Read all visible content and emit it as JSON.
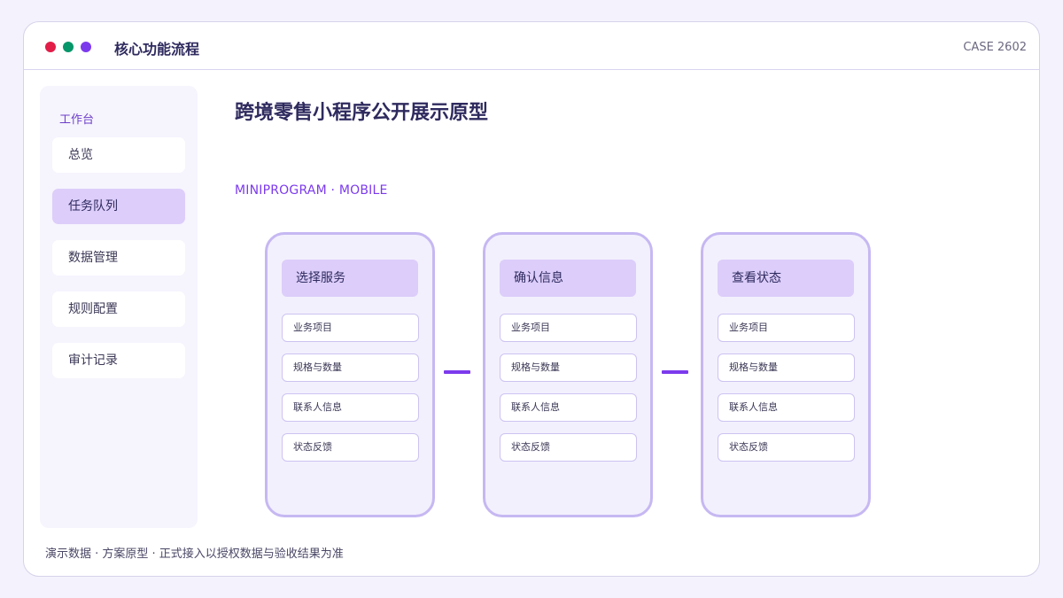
{
  "window": {
    "title": "核心功能流程",
    "case_id": "CASE 2602",
    "colors": {
      "dot_red": "#e11d48",
      "dot_green": "#059669",
      "dot_purple": "#7c3aed",
      "accent": "#7c3aed"
    }
  },
  "sidebar": {
    "heading": "工作台",
    "items": [
      {
        "label": "总览",
        "active": false
      },
      {
        "label": "任务队列",
        "active": true
      },
      {
        "label": "数据管理",
        "active": false
      },
      {
        "label": "规则配置",
        "active": false
      },
      {
        "label": "审计记录",
        "active": false
      }
    ]
  },
  "main": {
    "title": "跨境零售小程序公开展示原型",
    "subtitle": "MINIPROGRAM · MOBILE",
    "screens": [
      {
        "header": "选择服务",
        "fields": [
          "业务项目",
          "规格与数量",
          "联系人信息",
          "状态反馈"
        ]
      },
      {
        "header": "确认信息",
        "fields": [
          "业务项目",
          "规格与数量",
          "联系人信息",
          "状态反馈"
        ]
      },
      {
        "header": "查看状态",
        "fields": [
          "业务项目",
          "规格与数量",
          "联系人信息",
          "状态反馈"
        ]
      }
    ]
  },
  "footer": {
    "note": "演示数据 · 方案原型 · 正式接入以授权数据与验收结果为准"
  }
}
